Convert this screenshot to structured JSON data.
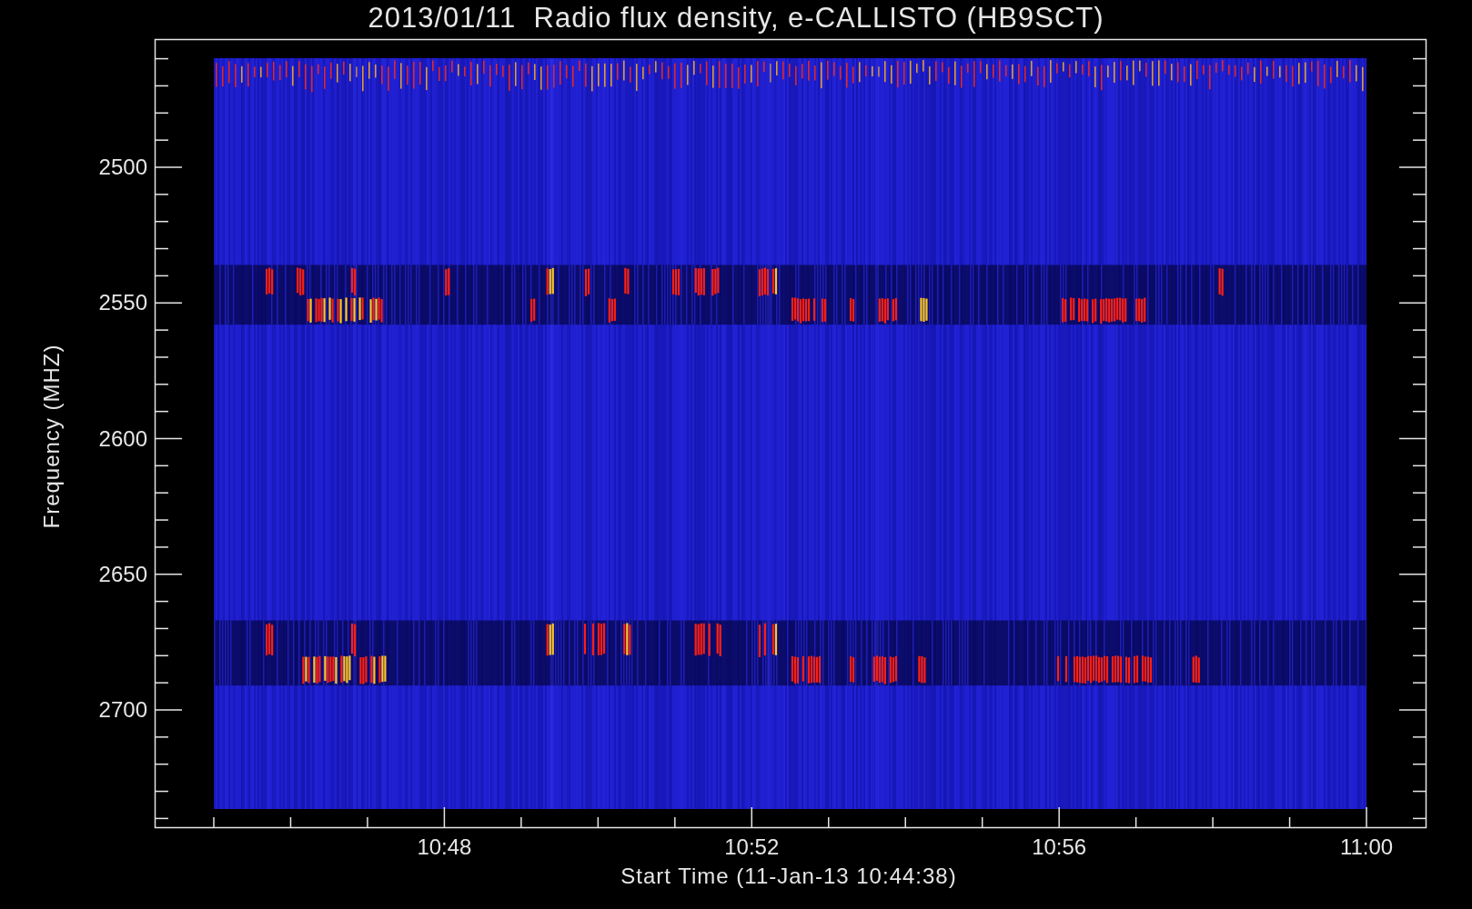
{
  "title": "2013/01/11  Radio flux density, e-CALLISTO (HB9SCT)",
  "ylabel": "Frequency (MHZ)",
  "xlabel": "Start Time (11-Jan-13 10:44:38)",
  "yticks": [
    "2500",
    "2550",
    "2600",
    "2650",
    "2700"
  ],
  "xticks": [
    "10:48",
    "10:52",
    "10:56",
    "11:00"
  ]
}
